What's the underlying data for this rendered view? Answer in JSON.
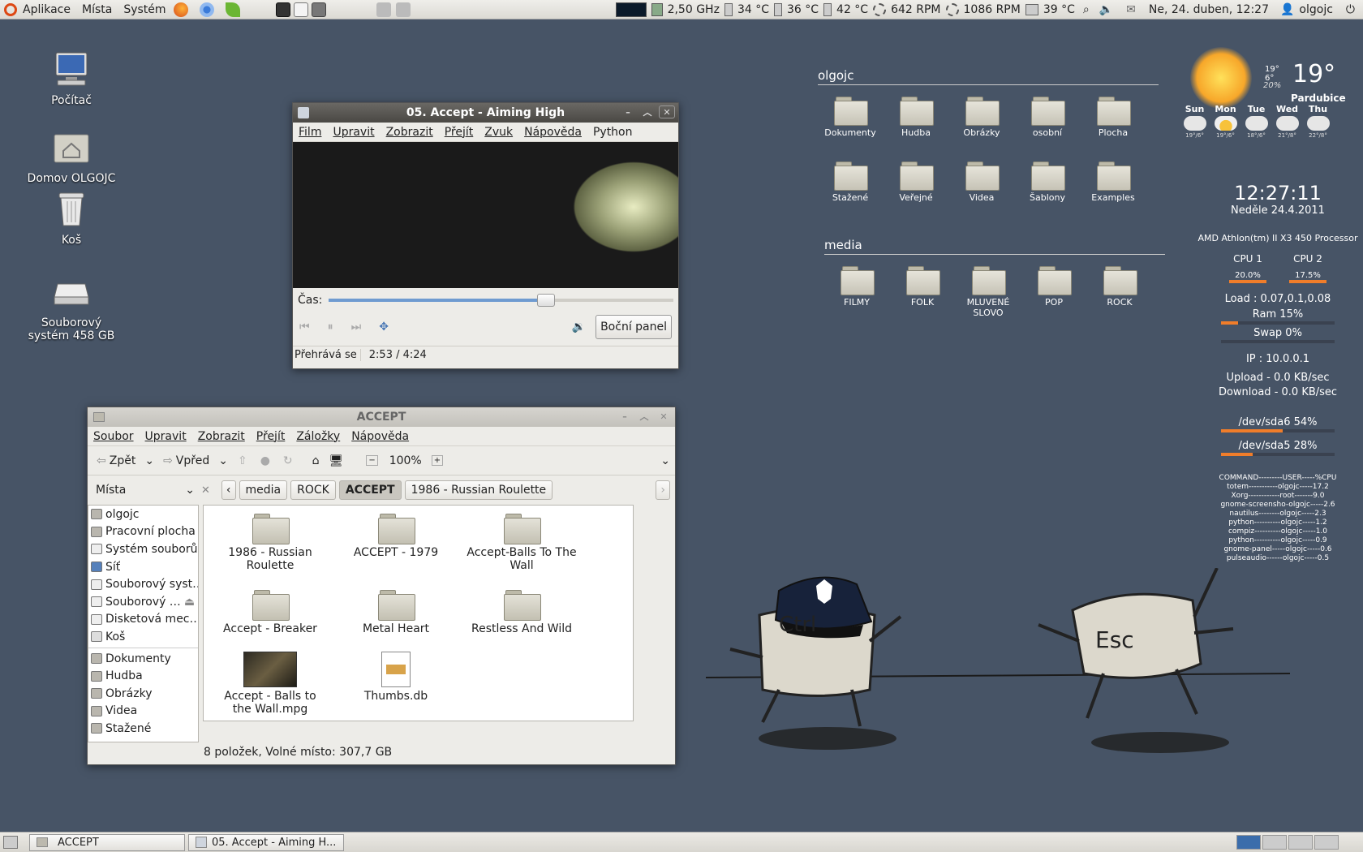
{
  "top_panel": {
    "menus": [
      "Aplikace",
      "Místa",
      "Systém"
    ],
    "cpu_freq": "2,50 GHz",
    "temps": [
      "34 °C",
      "36 °C",
      "42 °C"
    ],
    "fans": [
      "642 RPM",
      "1086 RPM"
    ],
    "hdd_temp": "39 °C",
    "datetime": "Ne, 24. duben, 12:27",
    "user": "olgojc"
  },
  "desktop_icons": [
    {
      "label": "Počítač"
    },
    {
      "label": "Domov OLGOJC"
    },
    {
      "label": "Koš"
    },
    {
      "label": "Souborový systém 458 GB"
    }
  ],
  "totem": {
    "title": "05. Accept - Aiming High",
    "menu": [
      "Film",
      "Upravit",
      "Zobrazit",
      "Přejít",
      "Zvuk",
      "Nápověda",
      "Python"
    ],
    "time_label": "Čas:",
    "progress": 0.63,
    "sidebar_button": "Boční panel",
    "status": "Přehrává se",
    "time": "2:53 / 4:24"
  },
  "nautilus": {
    "title": "ACCEPT",
    "menu": [
      "Soubor",
      "Upravit",
      "Zobrazit",
      "Přejít",
      "Záložky",
      "Nápověda"
    ],
    "back": "Zpět",
    "forward": "Vpřed",
    "zoom": "100%",
    "places_label": "Místa",
    "breadcrumbs": [
      "media",
      "ROCK",
      "ACCEPT",
      "1986 - Russian Roulette"
    ],
    "sidebar_items": [
      "olgojc",
      "Pracovní plocha",
      "Systém souborů",
      "Síť",
      "Souborový syst…",
      "Souborový …",
      "Disketová mec…",
      "Koš",
      "Dokumenty",
      "Hudba",
      "Obrázky",
      "Videa",
      "Stažené"
    ],
    "files": [
      {
        "name": "1986 - Russian Roulette",
        "type": "folder"
      },
      {
        "name": "ACCEPT - 1979",
        "type": "folder"
      },
      {
        "name": "Accept-Balls To The Wall",
        "type": "folder"
      },
      {
        "name": "Accept - Breaker",
        "type": "folder"
      },
      {
        "name": "Metal Heart",
        "type": "folder"
      },
      {
        "name": "Restless And Wild",
        "type": "folder"
      },
      {
        "name": "Accept - Balls to the Wall.mpg",
        "type": "video"
      },
      {
        "name": "Thumbs.db",
        "type": "file"
      }
    ],
    "status": "8 položek, Volné místo: 307,7 GB"
  },
  "desk_folders": {
    "group1_title": "olgojc",
    "group1": [
      "Dokumenty",
      "Hudba",
      "Obrázky",
      "osobní",
      "Plocha",
      "Stažené",
      "Veřejné",
      "Videa",
      "Šablony",
      "Examples"
    ],
    "group2_title": "media",
    "group2": [
      "FILMY",
      "FOLK",
      "MLUVENÉ SLOVO",
      "POP",
      "ROCK"
    ]
  },
  "weather": {
    "temp": "19°",
    "hi_lo": "19° 6°",
    "chance": "20%",
    "city": "Pardubice",
    "days": [
      {
        "day": "Sun",
        "temp": "19°/6°"
      },
      {
        "day": "Mon",
        "temp": "19°/6°"
      },
      {
        "day": "Tue",
        "temp": "18°/6°"
      },
      {
        "day": "Wed",
        "temp": "21°/8°"
      },
      {
        "day": "Thu",
        "temp": "22°/8°"
      }
    ]
  },
  "conky": {
    "time": "12:27:11",
    "date": "Neděle 24.4.2011",
    "cpu_name": "AMD Athlon(tm) II X3 450 Processor",
    "cpu1_label": "CPU 1",
    "cpu1": "20.0%",
    "cpu2_label": "CPU 2",
    "cpu2": "17.5%",
    "load": "Load : 0.07,0.1,0.08",
    "ram": "Ram 15%",
    "ram_fill": 0.15,
    "swap": "Swap 0%",
    "ip": "IP : 10.0.0.1",
    "upload": "Upload - 0.0 KB/sec",
    "download": "Download - 0.0 KB/sec",
    "disk1": "/dev/sda6 54%",
    "disk1_fill": 0.54,
    "disk2": "/dev/sda5 28%",
    "disk2_fill": 0.28,
    "process_header": "COMMAND---------USER-----%CPU",
    "processes": [
      "totem-----------olgojc-----17.2",
      "Xorg------------root-------9.0",
      "gnome-screensho-olgojc-----2.6",
      "nautilus--------olgojc-----2.3",
      "python----------olgojc-----1.2",
      "compiz----------olgojc-----1.0",
      "python----------olgojc-----0.9",
      "gnome-panel-----olgojc-----0.6",
      "pulseaudio------olgojc-----0.5"
    ]
  },
  "wallpaper": {
    "key1": "Ctrl",
    "key2": "Esc"
  },
  "taskbar": [
    "ACCEPT",
    "05. Accept - Aiming H..."
  ]
}
